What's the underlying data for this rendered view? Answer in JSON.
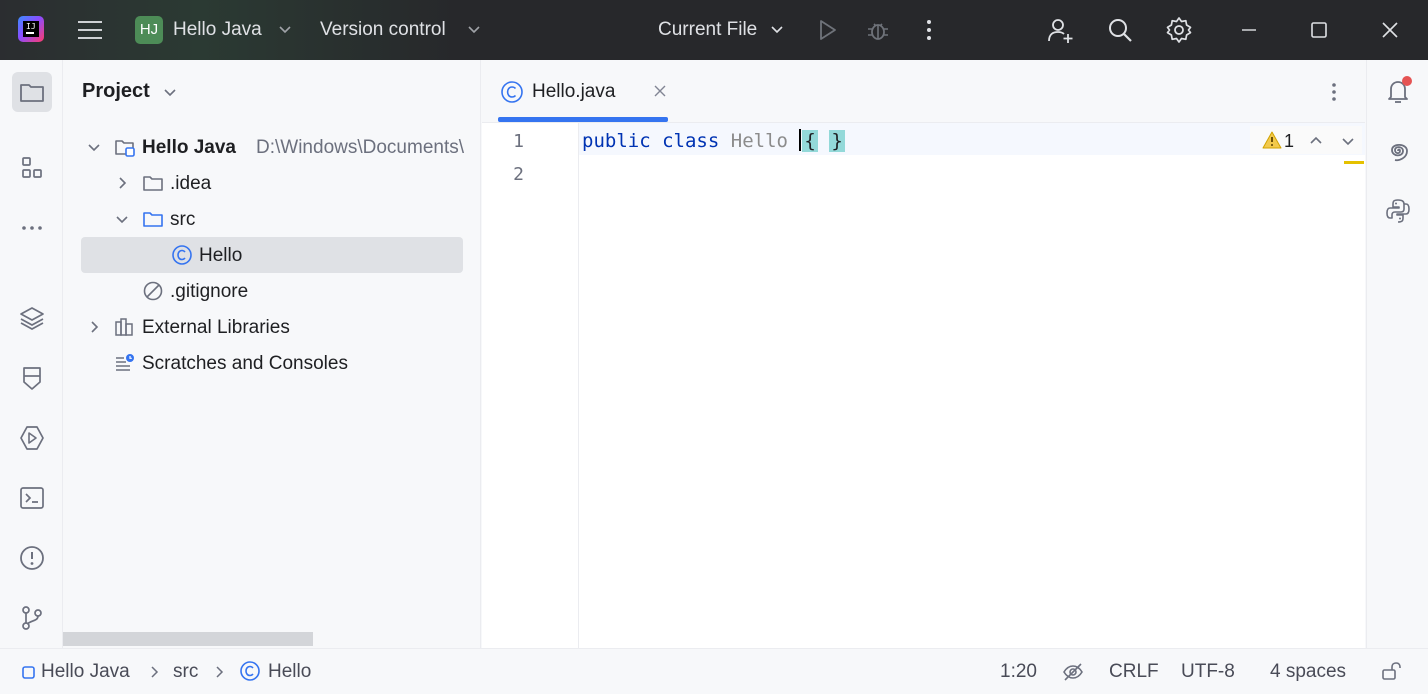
{
  "titlebar": {
    "project_initials": "HJ",
    "project_name": "Hello Java",
    "vcs_label": "Version control",
    "run_config": "Current File"
  },
  "left_strip": {
    "icons": [
      "folder-icon",
      "structure-icon",
      "more-icon",
      "layers-icon",
      "bookmark-icon",
      "run-icon",
      "terminal-icon",
      "problems-icon",
      "git-branch-icon"
    ]
  },
  "project_panel": {
    "title": "Project",
    "tree": [
      {
        "label": "Hello Java",
        "path": "D:\\Windows\\Documents\\",
        "expanded": true,
        "bold": true
      },
      {
        "label": ".idea",
        "expanded": false
      },
      {
        "label": "src",
        "expanded": true
      },
      {
        "label": "Hello",
        "selected": true
      },
      {
        "label": ".gitignore"
      },
      {
        "label": "External Libraries",
        "expanded": false
      },
      {
        "label": "Scratches and Consoles"
      }
    ]
  },
  "editor": {
    "tab_label": "Hello.java",
    "line_numbers": [
      "1",
      "2"
    ],
    "code": {
      "kw1": "public",
      "kw2": "class",
      "class_name": "Hello",
      "open_brace": "{",
      "close_brace": "}"
    },
    "warning_count": "1"
  },
  "statusbar": {
    "breadcrumb": [
      "Hello Java",
      "src",
      "Hello"
    ],
    "position": "1:20",
    "line_separator": "CRLF",
    "encoding": "UTF-8",
    "indent": "4 spaces"
  },
  "colors": {
    "accent": "#3574f0",
    "titlebar": "#27282b",
    "keyword": "#0033b3",
    "brace_highlight": "#93d9d9",
    "warning": "#e5c100"
  }
}
